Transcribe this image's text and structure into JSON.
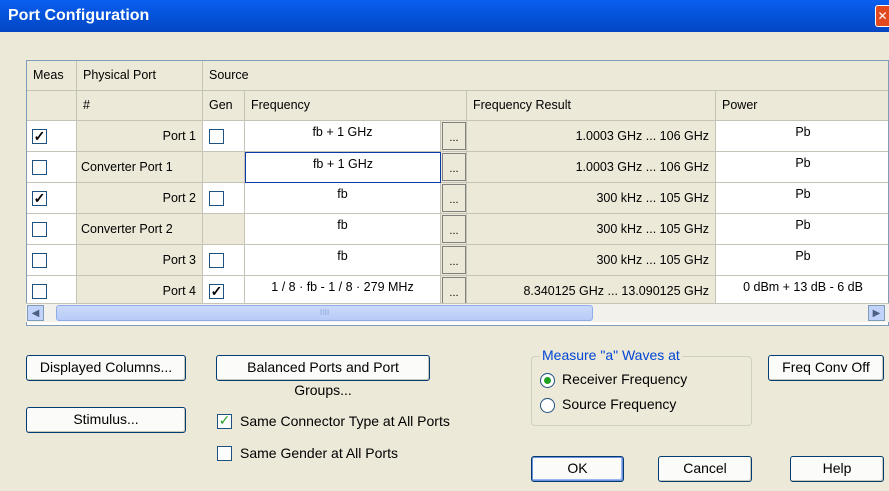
{
  "window": {
    "title": "Port Configuration",
    "close_glyph": "✕"
  },
  "grid": {
    "group_headers": {
      "meas": "Meas",
      "physical_port": "Physical Port",
      "source": "Source"
    },
    "sub_headers": {
      "num": "#",
      "gen": "Gen",
      "frequency": "Frequency",
      "frequency_result": "Frequency Result",
      "power": "Power"
    },
    "rows": [
      {
        "meas": true,
        "port": "Port 1",
        "port_align": "right",
        "gen": false,
        "gen_shown": true,
        "frequency": "fb + 1 GHz",
        "freq_result": "1.0003 GHz ... 106 GHz",
        "power": "Pb"
      },
      {
        "meas": false,
        "port": "Converter Port 1",
        "port_align": "left",
        "gen": false,
        "gen_shown": false,
        "frequency": "fb + 1 GHz",
        "freq_result": "1.0003 GHz ... 106 GHz",
        "power": "Pb"
      },
      {
        "meas": true,
        "port": "Port 2",
        "port_align": "right",
        "gen": false,
        "gen_shown": true,
        "frequency": "fb",
        "freq_result": "300 kHz ... 105 GHz",
        "power": "Pb"
      },
      {
        "meas": false,
        "port": "Converter Port 2",
        "port_align": "left",
        "gen": false,
        "gen_shown": false,
        "frequency": "fb",
        "freq_result": "300 kHz ... 105 GHz",
        "power": "Pb"
      },
      {
        "meas": false,
        "port": "Port 3",
        "port_align": "right",
        "gen": false,
        "gen_shown": true,
        "frequency": "fb",
        "freq_result": "300 kHz ... 105 GHz",
        "power": "Pb"
      },
      {
        "meas": false,
        "port": "Port 4",
        "port_align": "right",
        "gen": true,
        "gen_shown": true,
        "frequency": "1 / 8 · fb - 1 / 8 · 279 MHz",
        "freq_result": "8.340125 GHz ... 13.090125 GHz",
        "power": "0 dBm + 13 dB  - 6 dB"
      }
    ],
    "ellipsis": "...",
    "scroll_thumb_grip": "IIII"
  },
  "buttons": {
    "displayed_columns": "Displayed Columns...",
    "balanced_ports": "Balanced Ports and Port Groups...",
    "freq_conv_off": "Freq Conv Off",
    "stimulus": "Stimulus...",
    "ok": "OK",
    "cancel": "Cancel",
    "help": "Help"
  },
  "options": {
    "same_connector": {
      "label": "Same Connector Type at All Ports",
      "checked": true
    },
    "same_gender": {
      "label": "Same Gender at All Ports",
      "checked": false
    }
  },
  "measure_group": {
    "title": "Measure \"a\" Waves at",
    "receiver": {
      "label": "Receiver Frequency",
      "selected": true
    },
    "source": {
      "label": "Source Frequency",
      "selected": false
    }
  },
  "colors": {
    "title_bar": "#0453dc",
    "accent": "#21a121"
  }
}
